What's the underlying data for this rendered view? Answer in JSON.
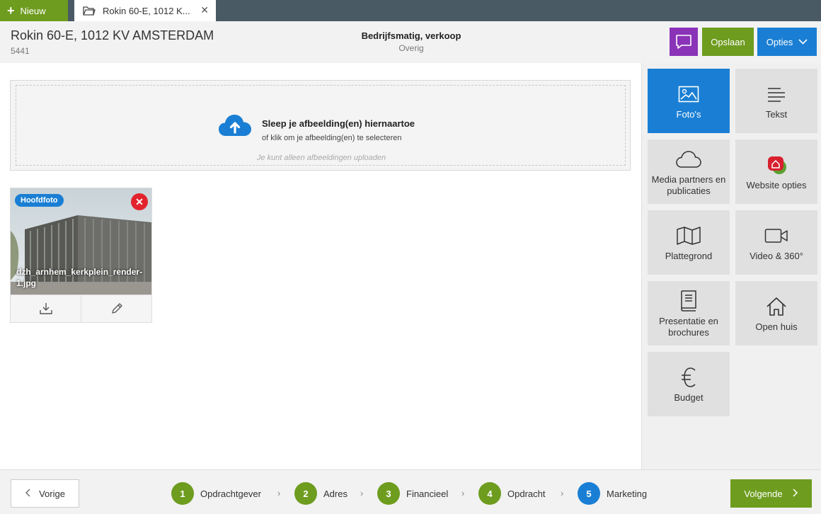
{
  "topbar": {
    "new_label": "Nieuw",
    "tab_title": "Rokin 60-E, 1012 K...",
    "tab_close": "✕"
  },
  "header": {
    "address": "Rokin 60-E, 1012 KV AMSTERDAM",
    "object_id": "5441",
    "type_title": "Bedrijfsmatig, verkoop",
    "type_sub": "Overig",
    "save_label": "Opslaan",
    "options_label": "Opties"
  },
  "upload": {
    "title": "Sleep je afbeelding(en) hiernaartoe",
    "subtitle": "of klik om je afbeelding(en) te selecteren",
    "note": "Je kunt alleen afbeeldingen uploaden"
  },
  "photos": [
    {
      "badge": "Hoofdfoto",
      "filename": "dzh_arnhem_kerkplein_render-1.jpg"
    }
  ],
  "menu": {
    "tiles": [
      {
        "label": "Foto's",
        "icon": "image-icon",
        "active": true
      },
      {
        "label": "Tekst",
        "icon": "text-lines-icon"
      },
      {
        "label": "Media partners en publicaties",
        "icon": "cloud-icon"
      },
      {
        "label": "Website opties",
        "icon": "website-logo-icon"
      },
      {
        "label": "Plattegrond",
        "icon": "map-icon"
      },
      {
        "label": "Video & 360°",
        "icon": "video-camera-icon"
      },
      {
        "label": "Presentatie en brochures",
        "icon": "book-icon"
      },
      {
        "label": "Open huis",
        "icon": "house-icon"
      },
      {
        "label": "Budget",
        "icon": "euro-icon"
      }
    ]
  },
  "footer": {
    "prev_label": "Vorige",
    "next_label": "Volgende",
    "steps": [
      {
        "num": "1",
        "label": "Opdrachtgever"
      },
      {
        "num": "2",
        "label": "Adres"
      },
      {
        "num": "3",
        "label": "Financieel"
      },
      {
        "num": "4",
        "label": "Opdracht"
      },
      {
        "num": "5",
        "label": "Marketing",
        "current": true
      }
    ]
  },
  "colors": {
    "green": "#6e9c1f",
    "blue": "#1a7fd4",
    "purple": "#8a33b8",
    "red": "#e2232d",
    "topbar": "#4a5a65"
  }
}
